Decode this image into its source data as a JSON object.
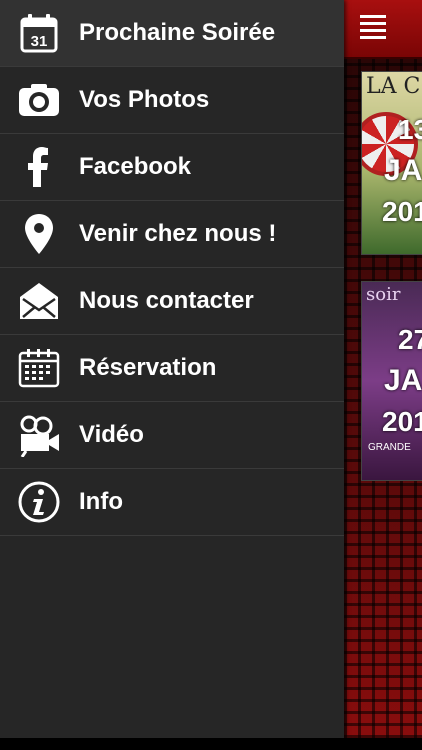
{
  "menu": {
    "items": [
      {
        "label": "Prochaine Soirée",
        "icon": "calendar-icon",
        "calendar_number": "31",
        "active": true
      },
      {
        "label": "Vos Photos",
        "icon": "camera-icon"
      },
      {
        "label": "Facebook",
        "icon": "facebook-icon"
      },
      {
        "label": "Venir chez nous !",
        "icon": "map-pin-icon"
      },
      {
        "label": "Nous contacter",
        "icon": "envelope-icon"
      },
      {
        "label": "Réservation",
        "icon": "calendar-grid-icon"
      },
      {
        "label": "Vidéo",
        "icon": "video-camera-icon"
      },
      {
        "label": "Info",
        "icon": "info-icon"
      }
    ]
  },
  "background": {
    "header_icon": "hamburger-icon",
    "events": [
      {
        "top_text": "LA C",
        "day": "13",
        "month": "JA",
        "year": "201"
      },
      {
        "top_text": "soir",
        "day": "27",
        "month": "JA",
        "year": "201",
        "footer": "GRANDE"
      }
    ]
  },
  "colors": {
    "drawer_bg": "#262626",
    "active_item_bg": "#323232",
    "header_red": "#a80f0f",
    "text": "#ffffff"
  }
}
